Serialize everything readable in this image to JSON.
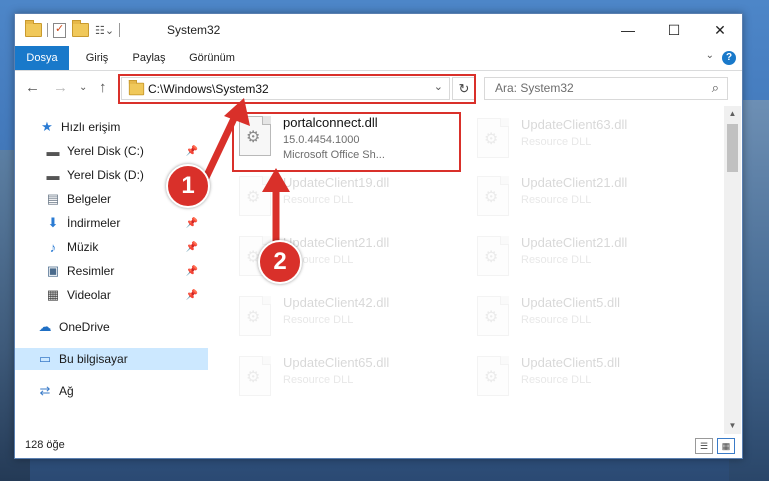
{
  "window": {
    "title": "System32",
    "controls": {
      "minimize": "—",
      "maximize": "☐",
      "close": "✕"
    }
  },
  "ribbon": {
    "tabs": [
      "Dosya",
      "Giriş",
      "Paylaş",
      "Görünüm"
    ],
    "help": "?",
    "expand": "⌄"
  },
  "navbar": {
    "back": "←",
    "forward": "→",
    "recent": "⌄",
    "up": "↑",
    "address": "C:\\Windows\\System32",
    "dropdown": "⌄",
    "refresh": "↻",
    "search_placeholder": "Ara: System32",
    "search_icon": "⌕"
  },
  "sidebar": {
    "items": [
      {
        "label": "Hızlı erişim",
        "icon": "★",
        "icon_color": "#2a7bd3",
        "pinned": false
      },
      {
        "label": "Yerel Disk (C:)",
        "icon": "▬",
        "icon_color": "#555555",
        "pinned": true
      },
      {
        "label": "Yerel Disk (D:)",
        "icon": "▬",
        "icon_color": "#555555",
        "pinned": true
      },
      {
        "label": "Belgeler",
        "icon": "▤",
        "icon_color": "#6c7a89",
        "pinned": true
      },
      {
        "label": "İndirmeler",
        "icon": "⬇",
        "icon_color": "#2a7bd3",
        "pinned": true
      },
      {
        "label": "Müzik",
        "icon": "♪",
        "icon_color": "#2a7bd3",
        "pinned": true
      },
      {
        "label": "Resimler",
        "icon": "▣",
        "icon_color": "#4a6b8c",
        "pinned": true
      },
      {
        "label": "Videolar",
        "icon": "▦",
        "icon_color": "#444444",
        "pinned": true
      },
      {
        "label": "OneDrive",
        "icon": "☁",
        "icon_color": "#1f6fc4",
        "pinned": false
      },
      {
        "label": "Bu bilgisayar",
        "icon": "▭",
        "icon_color": "#3a7bc8",
        "pinned": false
      },
      {
        "label": "Ağ",
        "icon": "⇄",
        "icon_color": "#3a7bc8",
        "pinned": false
      }
    ],
    "pin_glyph": "📌"
  },
  "files": [
    {
      "name": "portalconnect.dll",
      "line1": "15.0.4454.1000",
      "line2": "Microsoft Office Sh...",
      "faded": false
    },
    {
      "name": "UpdateClient63.dll",
      "line1": "Resource DLL",
      "line2": "",
      "faded": true
    },
    {
      "name": "UpdateClient19.dll",
      "line1": "Resource DLL",
      "line2": "",
      "faded": true
    },
    {
      "name": "UpdateClient21.dll",
      "line1": "Resource DLL",
      "line2": "",
      "faded": true
    },
    {
      "name": "UpdateClient21.dll",
      "line1": "Resource DLL",
      "line2": "",
      "faded": true
    },
    {
      "name": "UpdateClient21.dll",
      "line1": "Resource DLL",
      "line2": "",
      "faded": true
    },
    {
      "name": "UpdateClient42.dll",
      "line1": "Resource DLL",
      "line2": "",
      "faded": true
    },
    {
      "name": "UpdateClient5.dll",
      "line1": "Resource DLL",
      "line2": "",
      "faded": true
    },
    {
      "name": "UpdateClient65.dll",
      "line1": "Resource DLL",
      "line2": "",
      "faded": true
    },
    {
      "name": "UpdateClient5.dll",
      "line1": "Resource DLL",
      "line2": "",
      "faded": true
    }
  ],
  "status": {
    "count": "128 öğe",
    "view_details": "☰",
    "view_tiles": "▦"
  },
  "callouts": {
    "one": "1",
    "two": "2"
  },
  "colors": {
    "accent": "#1979ca",
    "highlight": "#d9302a",
    "selection": "#cce8ff"
  }
}
